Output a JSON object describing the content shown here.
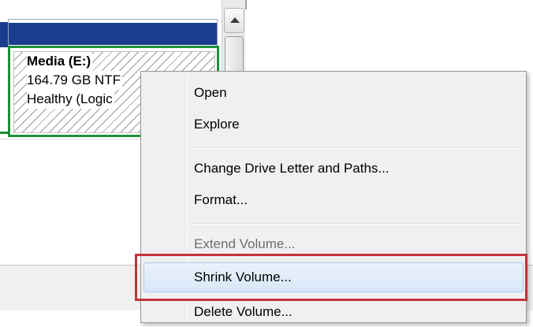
{
  "partition": {
    "name": "Media  (E:)",
    "size": "164.79 GB NTF",
    "status": "Healthy (Logic"
  },
  "context_menu": {
    "items": [
      {
        "label": "Open",
        "enabled": true
      },
      {
        "label": "Explore",
        "enabled": true
      },
      {
        "label": "Change Drive Letter and Paths...",
        "enabled": true
      },
      {
        "label": "Format...",
        "enabled": true
      },
      {
        "label": "Extend Volume...",
        "enabled": false
      },
      {
        "label": "Shrink Volume...",
        "enabled": true,
        "highlighted": true
      },
      {
        "label": "Delete Volume...",
        "enabled": true
      }
    ]
  },
  "colors": {
    "partition_header": "#1a3d8f",
    "partition_border": "#1e8f3a",
    "highlight_box": "#c0353a"
  },
  "icons": {
    "scroll_up": "up-arrow-icon"
  }
}
